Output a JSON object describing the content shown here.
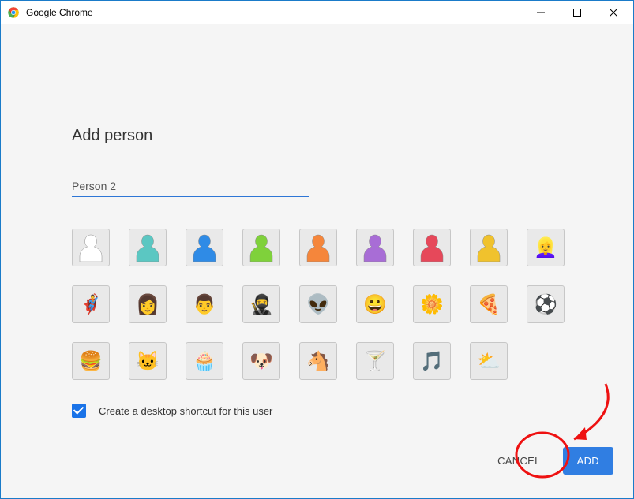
{
  "window": {
    "title": "Google Chrome"
  },
  "dialog": {
    "heading": "Add person",
    "name_input_value": "Person 2",
    "shortcut_label": "Create a desktop shortcut for this user",
    "shortcut_checked": true,
    "cancel_label": "CANCEL",
    "add_label": "ADD"
  },
  "avatars": [
    {
      "id": "silhouette-white",
      "type": "sil",
      "color": "#ffffff"
    },
    {
      "id": "silhouette-teal",
      "type": "sil",
      "color": "#5bc7c2"
    },
    {
      "id": "silhouette-blue",
      "type": "sil",
      "color": "#2f8be6"
    },
    {
      "id": "silhouette-green",
      "type": "sil",
      "color": "#7fd13b"
    },
    {
      "id": "silhouette-orange",
      "type": "sil",
      "color": "#f5863b"
    },
    {
      "id": "silhouette-purple",
      "type": "sil",
      "color": "#a86dd6"
    },
    {
      "id": "silhouette-red",
      "type": "sil",
      "color": "#e6485a"
    },
    {
      "id": "silhouette-yellow",
      "type": "sil",
      "color": "#f0c22d"
    },
    {
      "id": "avatar-woman-blonde",
      "type": "emoji",
      "glyph": "👱‍♀️"
    },
    {
      "id": "avatar-superhero",
      "type": "emoji",
      "glyph": "🦸‍♂️"
    },
    {
      "id": "avatar-woman-sunglasses",
      "type": "emoji",
      "glyph": "👩"
    },
    {
      "id": "avatar-man",
      "type": "emoji",
      "glyph": "👨"
    },
    {
      "id": "avatar-ninja",
      "type": "emoji",
      "glyph": "🥷"
    },
    {
      "id": "avatar-alien",
      "type": "emoji",
      "glyph": "👽"
    },
    {
      "id": "avatar-smiley",
      "type": "emoji",
      "glyph": "😀"
    },
    {
      "id": "avatar-flower",
      "type": "emoji",
      "glyph": "🌼"
    },
    {
      "id": "avatar-pizza",
      "type": "emoji",
      "glyph": "🍕"
    },
    {
      "id": "avatar-soccer",
      "type": "emoji",
      "glyph": "⚽"
    },
    {
      "id": "avatar-burger",
      "type": "emoji",
      "glyph": "🍔"
    },
    {
      "id": "avatar-cat",
      "type": "emoji",
      "glyph": "🐱"
    },
    {
      "id": "avatar-cupcake",
      "type": "emoji",
      "glyph": "🧁"
    },
    {
      "id": "avatar-dog",
      "type": "emoji",
      "glyph": "🐶"
    },
    {
      "id": "avatar-horse",
      "type": "emoji",
      "glyph": "🐴"
    },
    {
      "id": "avatar-cocktail",
      "type": "emoji",
      "glyph": "🍸"
    },
    {
      "id": "avatar-music-note",
      "type": "emoji",
      "glyph": "🎵"
    },
    {
      "id": "avatar-sun-cloud",
      "type": "emoji",
      "glyph": "⛅"
    }
  ]
}
